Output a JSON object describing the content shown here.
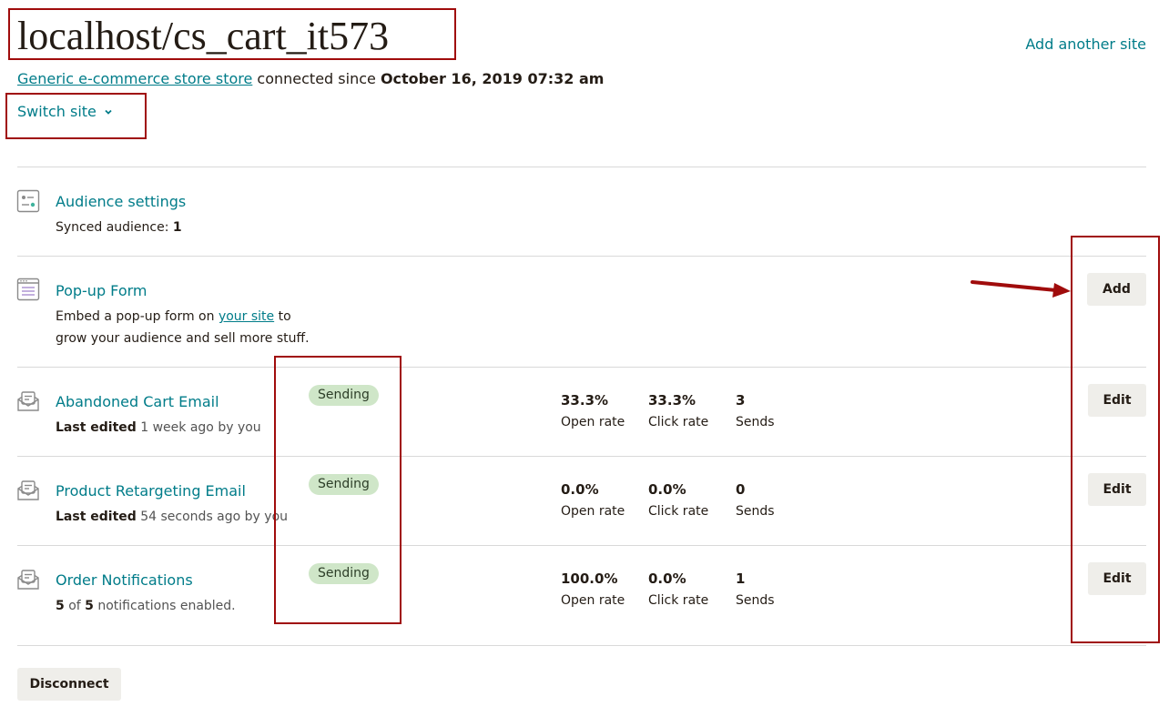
{
  "header": {
    "site_title": "localhost/cs_cart_it573",
    "add_site_link": "Add another site",
    "store_link": "Generic e-commerce store store",
    "connected_text": " connected since ",
    "connected_date": "October 16, 2019 07:32 am",
    "switch_site_label": "Switch site"
  },
  "audience": {
    "title": "Audience settings",
    "synced_label": "Synced audience: ",
    "synced_count": "1"
  },
  "popup": {
    "title": "Pop-up Form",
    "desc_before": "Embed a pop-up form on ",
    "desc_link": "your site",
    "desc_after": " to",
    "desc_line2": "grow your audience and sell more stuff.",
    "button": "Add"
  },
  "automations": [
    {
      "title": "Abandoned Cart Email",
      "sub_bold": "Last edited",
      "sub_rest": " 1 week ago by you",
      "status": "Sending",
      "open_rate": "33.3%",
      "click_rate": "33.3%",
      "sends": "3",
      "button": "Edit"
    },
    {
      "title": "Product Retargeting Email",
      "sub_bold": "Last edited",
      "sub_rest": " 54 seconds ago by you",
      "status": "Sending",
      "open_rate": "0.0%",
      "click_rate": "0.0%",
      "sends": "0",
      "button": "Edit"
    },
    {
      "title": "Order Notifications",
      "sub_bold": "5",
      "sub_mid": " of ",
      "sub_bold2": "5",
      "sub_rest": " notifications enabled.",
      "status": "Sending",
      "open_rate": "100.0%",
      "click_rate": "0.0%",
      "sends": "1",
      "button": "Edit"
    }
  ],
  "stat_labels": {
    "open_rate": "Open rate",
    "click_rate": "Click rate",
    "sends": "Sends"
  },
  "footer": {
    "disconnect_button": "Disconnect"
  },
  "colors": {
    "accent": "#007c89",
    "badge_bg": "#cfe6c8",
    "button_bg": "#efeeea",
    "annotation": "#a00c0c"
  }
}
